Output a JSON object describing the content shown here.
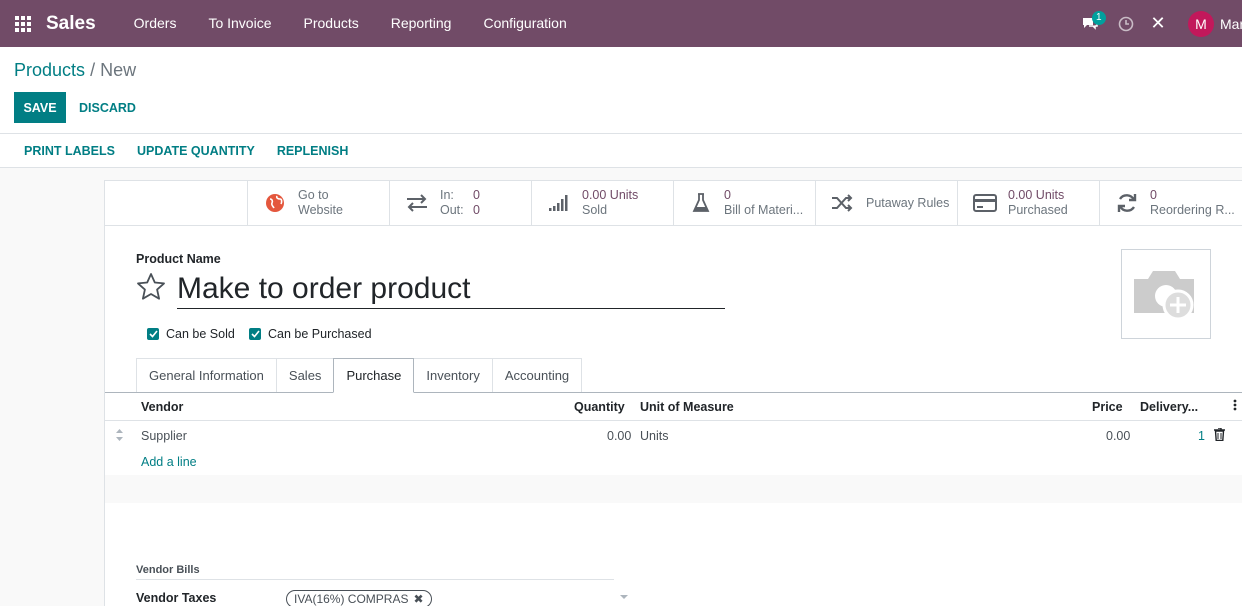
{
  "navbar": {
    "app_name": "Sales",
    "menu": [
      "Orders",
      "To Invoice",
      "Products",
      "Reporting",
      "Configuration"
    ],
    "chat_badge": "1",
    "avatar_letter": "M",
    "user_name": "Mar"
  },
  "breadcrumb": {
    "parent": "Products",
    "separator": "/",
    "current": "New"
  },
  "actions": {
    "save": "SAVE",
    "discard": "DISCARD"
  },
  "statusbar": [
    "PRINT LABELS",
    "UPDATE QUANTITY",
    "REPLENISH"
  ],
  "smart_buttons": {
    "website": {
      "line1": "Go to",
      "line2": "Website"
    },
    "inout": {
      "in_label": "In:",
      "in_value": "0",
      "out_label": "Out:",
      "out_value": "0"
    },
    "sold": {
      "value": "0.00 Units",
      "label": "Sold"
    },
    "bom": {
      "value": "0",
      "label": "Bill of Materi..."
    },
    "putaway": {
      "label": "Putaway Rules"
    },
    "purchased": {
      "value": "0.00 Units",
      "label": "Purchased"
    },
    "reordering": {
      "value": "0",
      "label": "Reordering R..."
    }
  },
  "form": {
    "name_label": "Product Name",
    "name_value": "Make to order product",
    "can_be_sold": "Can be Sold",
    "can_be_purchased": "Can be Purchased"
  },
  "tabs": [
    "General Information",
    "Sales",
    "Purchase",
    "Inventory",
    "Accounting"
  ],
  "active_tab": "Purchase",
  "vendor_table": {
    "headers": {
      "vendor": "Vendor",
      "quantity": "Quantity",
      "uom": "Unit of Measure",
      "price": "Price",
      "delivery": "Delivery..."
    },
    "rows": [
      {
        "vendor": "Supplier",
        "quantity": "0.00",
        "uom": "Units",
        "price": "0.00",
        "delivery": "1"
      }
    ],
    "add_line": "Add a line"
  },
  "vendor_bills": {
    "section_title": "Vendor Bills",
    "taxes_label": "Vendor Taxes",
    "tax_tag": "IVA(16%) COMPRAS",
    "tag_remove": "✖"
  },
  "colors": {
    "navbar": "#714b67",
    "primary": "#017e84",
    "avatar": "#c2185b"
  }
}
